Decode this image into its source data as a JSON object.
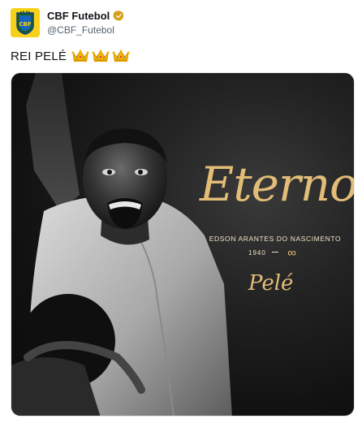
{
  "author": {
    "display_name": "CBF Futebol",
    "handle": "@CBF_Futebol",
    "verified": true,
    "avatar_icon": "cbf-crest-icon"
  },
  "tweet": {
    "text": "REI PELÉ",
    "emojis": [
      "crown-icon",
      "crown-icon",
      "crown-icon"
    ]
  },
  "media": {
    "headline": "Eterno",
    "full_name": "EDSON ARANTES DO NASCIMENTO",
    "birth_year": "1940",
    "death_symbol": "∞",
    "signature": "Pelé"
  },
  "colors": {
    "gold": "#e2bd78",
    "avatar_bg": "#f7d117",
    "verified": "#d4a017"
  }
}
